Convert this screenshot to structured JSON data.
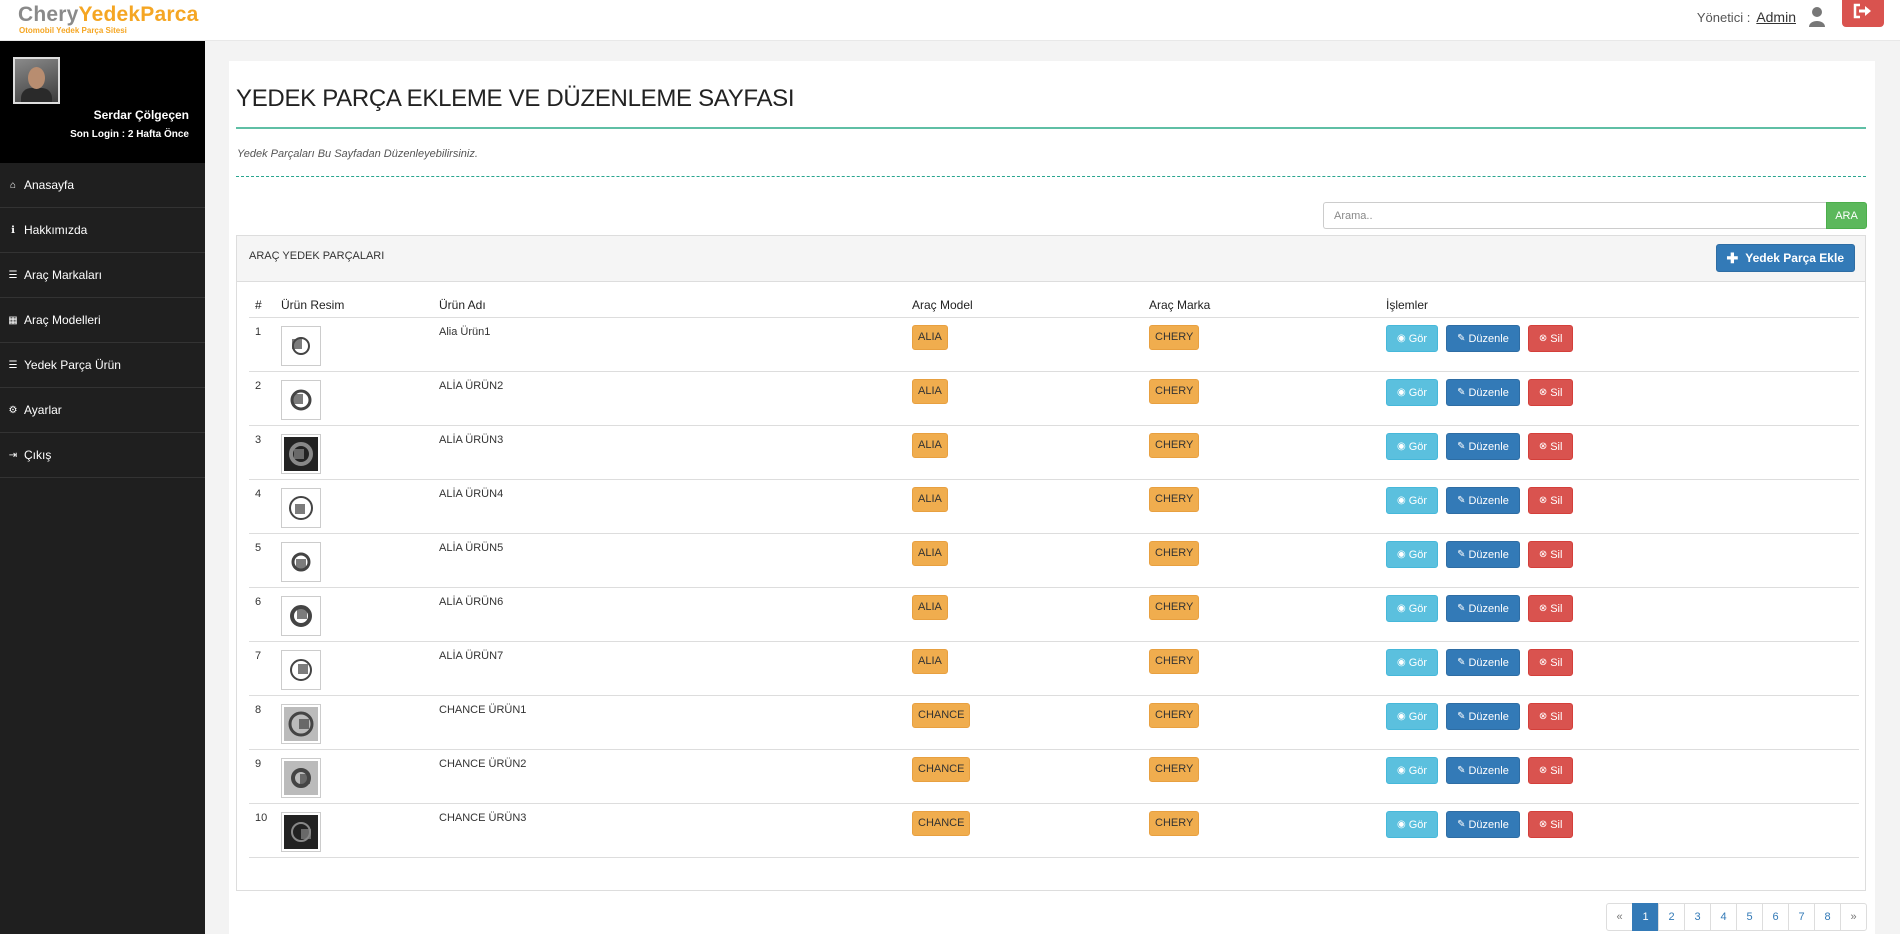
{
  "header": {
    "logo_part1": "Chery",
    "logo_part2": "YedekParca",
    "logo_sub": "Otomobil Yedek Parça Sitesi",
    "admin_label": "Yönetici :",
    "admin_name": "Admin"
  },
  "profile": {
    "name": "Serdar Çölgeçen",
    "login": "Son Login : 2 Hafta Önce"
  },
  "sidebar": {
    "items": [
      {
        "label": "Anasayfa",
        "icon": "home-icon",
        "glyph": "⌂"
      },
      {
        "label": "Hakkımızda",
        "icon": "info-icon",
        "glyph": "ℹ"
      },
      {
        "label": "Araç Markaları",
        "icon": "list-icon",
        "glyph": "☰"
      },
      {
        "label": "Araç Modelleri",
        "icon": "grid-icon",
        "glyph": "▦"
      },
      {
        "label": "Yedek Parça Ürün",
        "icon": "list-icon",
        "glyph": "☰"
      },
      {
        "label": "Ayarlar",
        "icon": "gear-icon",
        "glyph": "⚙"
      },
      {
        "label": "Çıkış",
        "icon": "logout-icon",
        "glyph": "⇥"
      }
    ]
  },
  "page": {
    "title": "YEDEK PARÇA EKLEME VE DÜZENLEME SAYFASI",
    "subtitle": "Yedek Parçaları Bu Sayfadan Düzenleyebilirsiniz.",
    "search_placeholder": "Arama..",
    "search_button": "ARA",
    "panel_title": "ARAÇ YEDEK PARÇALARI",
    "add_button": "Yedek Parça Ekle"
  },
  "table": {
    "headers": [
      "#",
      "Ürün Resim",
      "Ürün Adı",
      "Araç Model",
      "Araç Marka",
      "İşlemler"
    ],
    "rows": [
      {
        "num": "1",
        "name": "Alia Ürün1",
        "model": "ALIA",
        "brand": "CHERY"
      },
      {
        "num": "2",
        "name": "ALİA ÜRÜN2",
        "model": "ALIA",
        "brand": "CHERY"
      },
      {
        "num": "3",
        "name": "ALİA ÜRÜN3",
        "model": "ALIA",
        "brand": "CHERY"
      },
      {
        "num": "4",
        "name": "ALİA ÜRÜN4",
        "model": "ALIA",
        "brand": "CHERY"
      },
      {
        "num": "5",
        "name": "ALİA ÜRÜN5",
        "model": "ALIA",
        "brand": "CHERY"
      },
      {
        "num": "6",
        "name": "ALİA ÜRÜN6",
        "model": "ALIA",
        "brand": "CHERY"
      },
      {
        "num": "7",
        "name": "ALİA ÜRÜN7",
        "model": "ALIA",
        "brand": "CHERY"
      },
      {
        "num": "8",
        "name": "CHANCE ÜRÜN1",
        "model": "CHANCE",
        "brand": "CHERY"
      },
      {
        "num": "9",
        "name": "CHANCE ÜRÜN2",
        "model": "CHANCE",
        "brand": "CHERY"
      },
      {
        "num": "10",
        "name": "CHANCE ÜRÜN3",
        "model": "CHANCE",
        "brand": "CHERY"
      }
    ],
    "actions": {
      "view": "Gör",
      "edit": "Düzenle",
      "delete": "Sil"
    }
  },
  "pagination": {
    "prev": "«",
    "pages": [
      "1",
      "2",
      "3",
      "4",
      "5",
      "6",
      "7",
      "8"
    ],
    "next": "»",
    "active": "1"
  },
  "colors": {
    "view": "#5bc0de",
    "edit": "#337ab7",
    "delete": "#d9534f",
    "badge": "#f0ad4e",
    "search": "#5cb85c"
  }
}
